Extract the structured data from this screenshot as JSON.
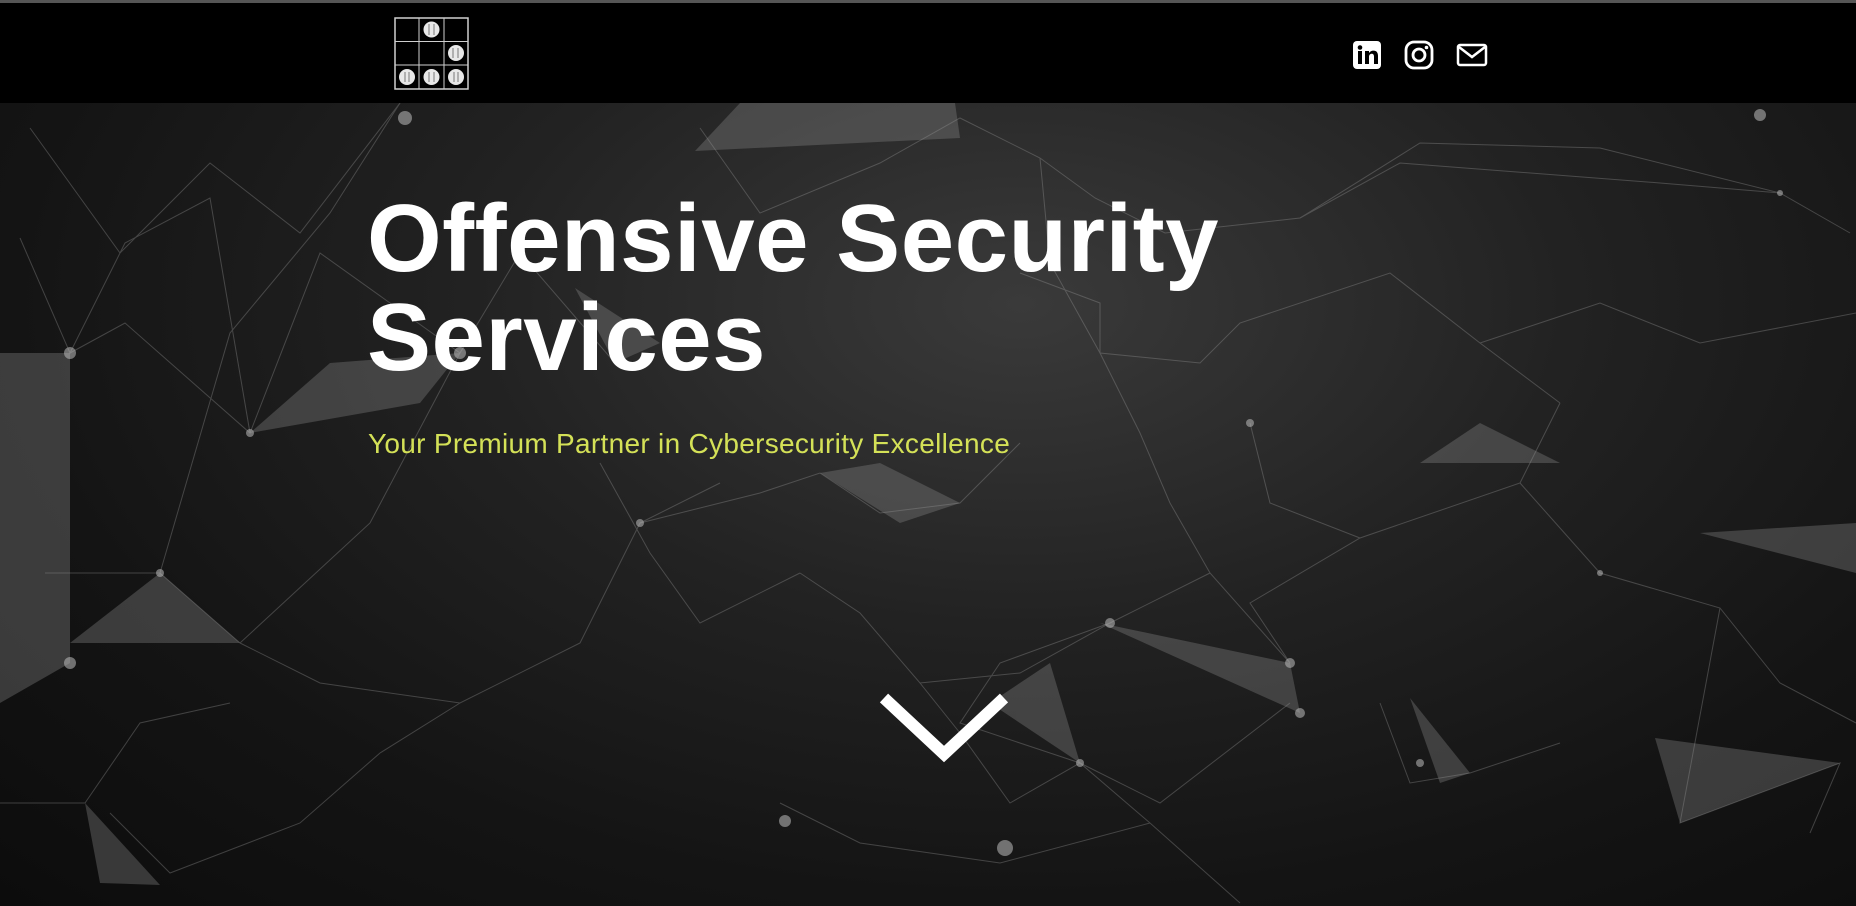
{
  "header": {
    "logo_icon": "grid-dots-logo",
    "social": [
      {
        "name": "linkedin",
        "icon": "linkedin-icon"
      },
      {
        "name": "instagram",
        "icon": "instagram-icon"
      },
      {
        "name": "email",
        "icon": "mail-icon"
      }
    ]
  },
  "hero": {
    "title_line1": "Offensive Security",
    "title_line2": "Services",
    "subtitle": "Your Premium Partner in Cybersecurity Excellence",
    "scroll_icon": "chevron-down-icon"
  },
  "colors": {
    "header_bg": "#000000",
    "title": "#ffffff",
    "subtitle": "#d4e157",
    "hero_bg": "#1a1a1a"
  }
}
